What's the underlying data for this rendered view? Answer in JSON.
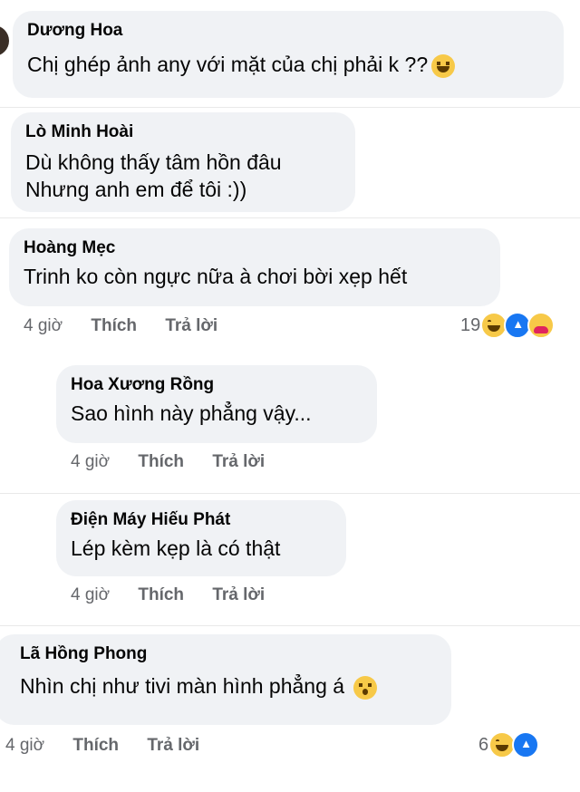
{
  "comments": [
    {
      "name": "Dương Hoa",
      "lines": [
        "Chị ghép ảnh any với mặt của chị phải k ??"
      ],
      "emoji": "laugh"
    },
    {
      "name": "Lò Minh Hoài",
      "lines": [
        "Dù không thấy tâm hồn đâu",
        "Nhưng anh em để tôi :))"
      ]
    },
    {
      "name": "Hoàng Mẹc",
      "lines": [
        "Trinh ko còn ngực nữa à chơi bời xẹp hết"
      ],
      "time": "4 giờ",
      "like": "Thích",
      "reply": "Trả lời",
      "reaction_count": "19",
      "reactions": [
        "haha-icon",
        "like-icon",
        "care-icon"
      ]
    },
    {
      "name": "Hoa Xương Rồng",
      "lines": [
        "Sao hình này phẳng vậy..."
      ],
      "time": "4 giờ",
      "like": "Thích",
      "reply": "Trả lời"
    },
    {
      "name": "Điện Máy Hiếu Phát",
      "lines": [
        "Lép kèm kẹp là có thật"
      ],
      "time": "4 giờ",
      "like": "Thích",
      "reply": "Trả lời"
    },
    {
      "name": "Lã Hồng Phong",
      "lines": [
        "Nhìn chị như tivi màn hình phẳng á"
      ],
      "emoji": "wow",
      "time": "4 giờ",
      "like": "Thích",
      "reply": "Trả lời",
      "reaction_count": "6",
      "reactions": [
        "haha-icon",
        "like-icon"
      ]
    }
  ]
}
